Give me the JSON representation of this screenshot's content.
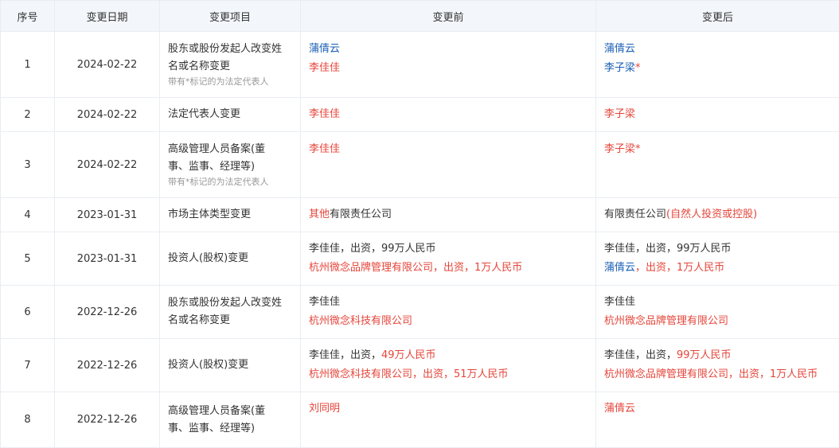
{
  "colors": {
    "red": "#e5453a",
    "blue": "#1a5fb4",
    "header_bg": "#f3f6fb",
    "border": "#e9edf3"
  },
  "headers": [
    "序号",
    "变更日期",
    "变更项目",
    "变更前",
    "变更后"
  ],
  "note": "带有*标记的为法定代表人",
  "rows": [
    {
      "no": "1",
      "date": "2024-02-22",
      "item": "股东或股份发起人改变姓名或名称变更",
      "item_l1": "股东或股份发起人改变姓",
      "item_l2": "名或名称变更",
      "before": [
        {
          "parts": [
            {
              "t": "蒲倩云",
              "c": "blue"
            }
          ]
        },
        {
          "parts": [
            {
              "t": "李佳佳",
              "c": "red"
            }
          ]
        }
      ],
      "after": [
        {
          "parts": [
            {
              "t": "蒲倩云",
              "c": "blue"
            }
          ]
        },
        {
          "parts": [
            {
              "t": "李子梁",
              "c": "blue"
            },
            {
              "t": "*",
              "c": "red"
            }
          ]
        }
      ]
    },
    {
      "no": "2",
      "date": "2024-02-22",
      "item": "法定代表人变更",
      "before": [
        {
          "parts": [
            {
              "t": "李佳佳",
              "c": "red"
            }
          ]
        }
      ],
      "after": [
        {
          "parts": [
            {
              "t": "李子梁",
              "c": "red"
            }
          ]
        }
      ]
    },
    {
      "no": "3",
      "date": "2024-02-22",
      "item_l1": "高级管理人员备案(董",
      "item_l2": "事、监事、经理等)",
      "before": [
        {
          "parts": [
            {
              "t": "李佳佳",
              "c": "red"
            }
          ]
        }
      ],
      "after": [
        {
          "parts": [
            {
              "t": "李子梁*",
              "c": "red"
            }
          ]
        }
      ]
    },
    {
      "no": "4",
      "date": "2023-01-31",
      "item": "市场主体类型变更",
      "before": [
        {
          "parts": [
            {
              "t": "其他",
              "c": "red"
            },
            {
              "t": "有限责任公司",
              "c": "dark"
            }
          ]
        }
      ],
      "after": [
        {
          "parts": [
            {
              "t": "有限责任公司",
              "c": "dark"
            },
            {
              "t": "(自然人投资或控股)",
              "c": "red"
            }
          ]
        }
      ]
    },
    {
      "no": "5",
      "date": "2023-01-31",
      "item": "投资人(股权)变更",
      "before": [
        {
          "parts": [
            {
              "t": "李佳佳，出资，99万人民币",
              "c": "dark"
            }
          ]
        },
        {
          "parts": [
            {
              "t": "杭州微念品牌管理有限公司，出资，1万人民币",
              "c": "red"
            }
          ]
        }
      ],
      "after": [
        {
          "parts": [
            {
              "t": "李佳佳，出资，99万人民币",
              "c": "dark"
            }
          ]
        },
        {
          "parts": [
            {
              "t": "蒲倩云",
              "c": "blue"
            },
            {
              "t": "，出资，1万人民币",
              "c": "red"
            }
          ]
        }
      ]
    },
    {
      "no": "6",
      "date": "2022-12-26",
      "item_l1": "股东或股份发起人改变姓",
      "item_l2": "名或名称变更",
      "before": [
        {
          "parts": [
            {
              "t": "李佳佳",
              "c": "dark"
            }
          ]
        },
        {
          "parts": [
            {
              "t": "杭州微念科技有限公司",
              "c": "red"
            }
          ]
        }
      ],
      "after": [
        {
          "parts": [
            {
              "t": "李佳佳",
              "c": "dark"
            }
          ]
        },
        {
          "parts": [
            {
              "t": "杭州微念品牌管理有限公司",
              "c": "red"
            }
          ]
        }
      ]
    },
    {
      "no": "7",
      "date": "2022-12-26",
      "item": "投资人(股权)变更",
      "before": [
        {
          "parts": [
            {
              "t": "李佳佳，出资，",
              "c": "dark"
            },
            {
              "t": "49万人民币",
              "c": "red"
            }
          ]
        },
        {
          "parts": [
            {
              "t": "杭州微念科技有限公司，出资，51万人民币",
              "c": "red"
            }
          ]
        }
      ],
      "after": [
        {
          "parts": [
            {
              "t": "李佳佳，出资，",
              "c": "dark"
            },
            {
              "t": "99万人民币",
              "c": "red"
            }
          ]
        },
        {
          "parts": [
            {
              "t": "杭州微念品牌管理有限公司，出资，1万人民币",
              "c": "red"
            }
          ]
        }
      ]
    },
    {
      "no": "8",
      "date": "2022-12-26",
      "item_l1": "高级管理人员备案(董",
      "item_l2": "事、监事、经理等)",
      "before": [
        {
          "parts": [
            {
              "t": "刘同明",
              "c": "red"
            }
          ]
        }
      ],
      "after": [
        {
          "parts": [
            {
              "t": "蒲倩云",
              "c": "red"
            }
          ]
        }
      ]
    }
  ]
}
